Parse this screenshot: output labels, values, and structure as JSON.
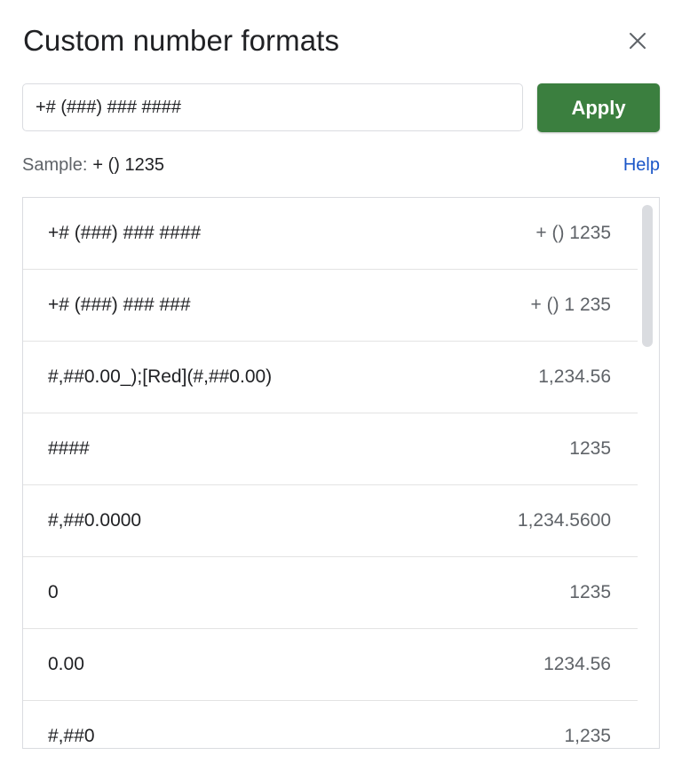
{
  "dialog": {
    "title": "Custom number formats",
    "close_icon": "close-icon"
  },
  "input": {
    "value": "+# (###) ### ####"
  },
  "apply_button": {
    "label": "Apply",
    "color": "#3b7f3f"
  },
  "sample": {
    "label": "Sample:",
    "value": "+ () 1235"
  },
  "help": {
    "label": "Help",
    "color": "#1a56c8"
  },
  "formats": [
    {
      "format": "+# (###) ### ####",
      "sample": "+ () 1235"
    },
    {
      "format": "+# (###) ### ###",
      "sample": "+ () 1 235"
    },
    {
      "format": "#,##0.00_);[Red](#,##0.00)",
      "sample": "1,234.56"
    },
    {
      "format": "####",
      "sample": "1235"
    },
    {
      "format": "#,##0.0000",
      "sample": "1,234.5600"
    },
    {
      "format": "0",
      "sample": "1235"
    },
    {
      "format": "0.00",
      "sample": "1234.56"
    },
    {
      "format": "#,##0",
      "sample": "1,235"
    }
  ]
}
